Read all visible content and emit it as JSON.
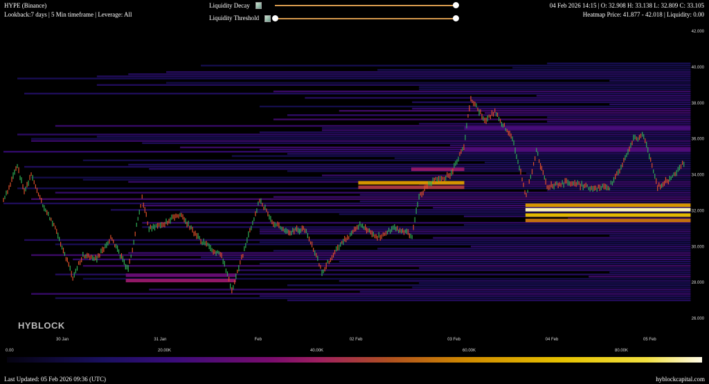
{
  "header": {
    "symbol": "HYPE (Binance)",
    "subtitle": "Lookback:7 days | 5 Min timeframe | Leverage: All",
    "ohlc": "04 Feb 2026 14:15 | O: 32.908 H: 33.138 L: 32.809 C: 33.105",
    "heatmap_info": "Heatmap Price: 41.877 - 42.018 | Liquidity: 0.00"
  },
  "controls": {
    "decay_label": "Liquidity Decay",
    "decay_value": 1.0,
    "threshold_label": "Liquidity Threshold",
    "threshold_range": [
      0.0,
      1.0
    ]
  },
  "footer": {
    "last_updated": "Last Updated: 05 Feb 2026 09:36 (UTC)",
    "site": "hyblockcapital.com",
    "logo": "HYBLOCK"
  },
  "colors": {
    "background": "#000000",
    "up": "#2fae55",
    "down": "#e0502a",
    "slider": "#d79a4e"
  },
  "chart_data": {
    "type": "heatmap",
    "title": "HYPE (Binance) Liquidation Heatmap",
    "ylim": [
      26,
      42
    ],
    "y_ticks": [
      "42.000",
      "40.000",
      "38.000",
      "36.000",
      "34.000",
      "32.000",
      "30.000",
      "28.000",
      "26.000"
    ],
    "x_ticks": [
      "30 Jan",
      "31 Jan",
      "Feb",
      "02 Feb",
      "03 Feb",
      "04 Feb",
      "05 Feb"
    ],
    "x_unit": "hours since 29 Jan 09:36",
    "colorbar": {
      "range": [
        0,
        90000
      ],
      "ticks": [
        "0.00",
        "20.00K",
        "40.00K",
        "60.00K",
        "80.00K"
      ]
    },
    "price_series": {
      "hours": [
        0,
        3.4,
        5.1,
        6.8,
        9.3,
        12.7,
        17,
        19.5,
        22.9,
        26.3,
        30.6,
        34,
        35.7,
        39.9,
        43.3,
        48.4,
        53.5,
        56,
        57.7,
        62.8,
        66.2,
        69.6,
        73.9,
        78.1,
        82.3,
        87.4,
        91.7,
        95.9,
        100.2,
        101.9,
        105.3,
        109.5,
        112.9,
        114.6,
        118,
        120.5,
        124.8,
        128.2,
        130.7,
        133.3,
        138.4,
        143.5,
        148.6,
        151.1,
        154.5,
        157,
        160.4,
        164.7,
        167.2
      ],
      "price": [
        32.5,
        34.5,
        33,
        34,
        32.5,
        31,
        28.3,
        29.5,
        29.3,
        30.5,
        28.7,
        32.7,
        31,
        31.3,
        31.8,
        30.3,
        29.5,
        27.6,
        28.8,
        32.6,
        31.3,
        30.8,
        31,
        28.6,
        30,
        31.2,
        30.5,
        31,
        30.6,
        32.8,
        33.7,
        33.9,
        35.6,
        38.3,
        37,
        37.5,
        36,
        32.8,
        35.3,
        33.3,
        33.6,
        33.3,
        33.3,
        34.3,
        36,
        36.2,
        33.3,
        34,
        34.8
      ]
    },
    "liquidity_bands": [
      {
        "price": 32.05,
        "start_hour": 128,
        "liquidity": 88000
      },
      {
        "price": 32.3,
        "start_hour": 128,
        "liquidity": 62000
      },
      {
        "price": 31.75,
        "start_hour": 128,
        "liquidity": 70000
      },
      {
        "price": 31.45,
        "start_hour": 128,
        "liquidity": 55000
      },
      {
        "price": 33.55,
        "start_hour": 87,
        "end_hour": 113,
        "liquidity": 62000
      },
      {
        "price": 33.3,
        "start_hour": 87,
        "end_hour": 113,
        "liquidity": 45000
      },
      {
        "price": 34.3,
        "start_hour": 100,
        "end_hour": 113,
        "liquidity": 38000
      },
      {
        "price": 28.1,
        "start_hour": 30,
        "end_hour": 57,
        "liquidity": 38000
      },
      {
        "price": 28.4,
        "start_hour": 30,
        "end_hour": 57,
        "liquidity": 30000
      },
      {
        "price": 35.4,
        "start_hour": 113,
        "liquidity": 26000
      },
      {
        "price": 36.6,
        "start_hour": 113,
        "liquidity": 24000
      }
    ]
  }
}
